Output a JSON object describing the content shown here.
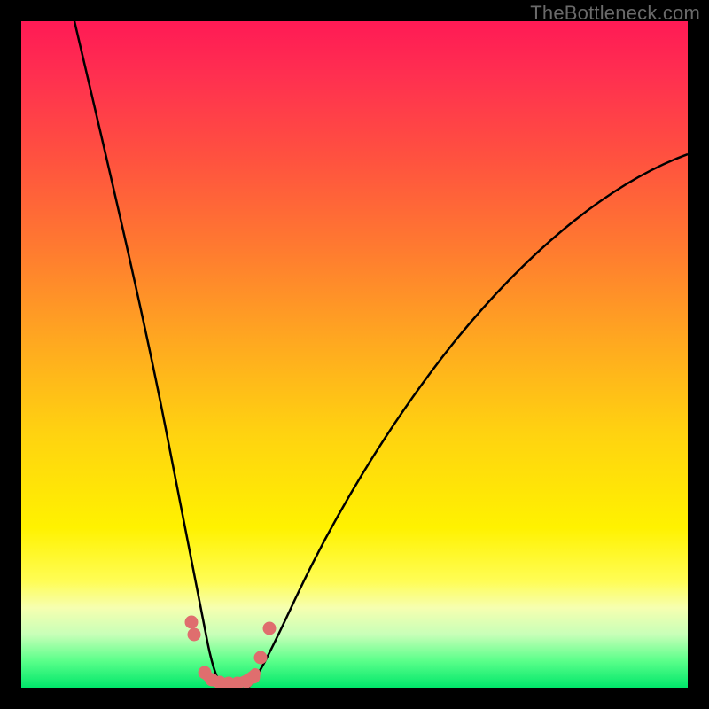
{
  "watermark": "TheBottleneck.com",
  "chart_data": {
    "type": "line",
    "title": "",
    "xlabel": "",
    "ylabel": "",
    "xlim": [
      0,
      100
    ],
    "ylim": [
      0,
      100
    ],
    "grid": false,
    "legend": false,
    "series": [
      {
        "name": "left-curve",
        "color": "#000000",
        "x": [
          8,
          12,
          16,
          19,
          22,
          24,
          26,
          27,
          28,
          29,
          30
        ],
        "y": [
          100,
          80,
          60,
          40,
          24,
          14,
          8,
          4,
          2,
          1,
          0
        ]
      },
      {
        "name": "right-curve",
        "color": "#000000",
        "x": [
          34,
          36,
          40,
          46,
          54,
          64,
          76,
          88,
          100
        ],
        "y": [
          0,
          2,
          8,
          18,
          30,
          44,
          58,
          70,
          80
        ]
      },
      {
        "name": "valley-markers",
        "color": "#e07070",
        "x": [
          25.5,
          25.7,
          27.5,
          29.0,
          30.5,
          32.0,
          33.5,
          35.0,
          36.0,
          37.2
        ],
        "y": [
          10,
          8,
          2.5,
          1.5,
          1.2,
          1.2,
          1.5,
          2.5,
          5,
          9
        ]
      }
    ],
    "gradient_stops": [
      {
        "position": 0,
        "color": "#ff1a55",
        "label": "red"
      },
      {
        "position": 50,
        "color": "#ffd310",
        "label": "yellow"
      },
      {
        "position": 100,
        "color": "#00e66a",
        "label": "green"
      }
    ]
  }
}
